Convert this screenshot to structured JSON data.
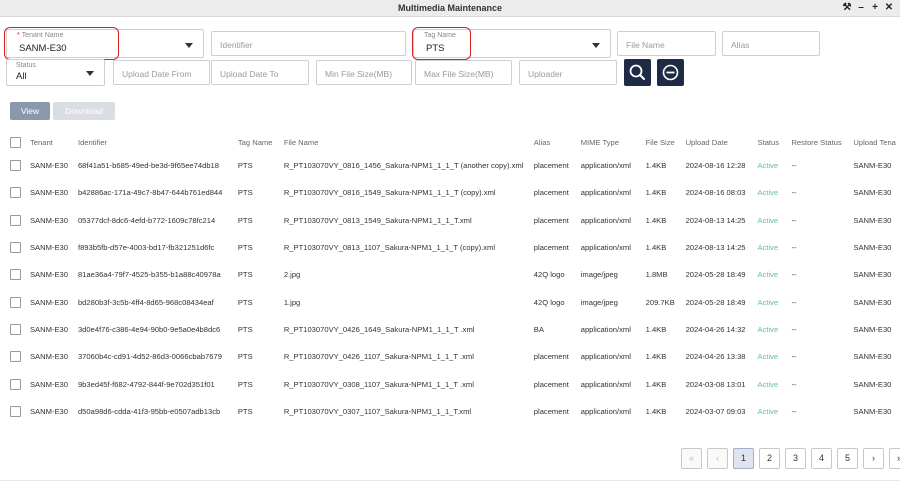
{
  "window": {
    "title": "Multimedia Maintenance",
    "controls": [
      "⚒",
      "–",
      "+",
      "✕"
    ]
  },
  "filters": {
    "tenant": {
      "label": "Tenant Name",
      "value": "SANM-E30"
    },
    "identifier_placeholder": "Identifier",
    "tag": {
      "label": "Tag Name",
      "value": "PTS"
    },
    "file_name_placeholder": "File Name",
    "alias_placeholder": "Alias",
    "status": {
      "label": "Status",
      "value": "All"
    },
    "upload_date_from_placeholder": "Upload Date From",
    "upload_date_to_placeholder": "Upload Date To",
    "min_size_placeholder": "Min File Size(MB)",
    "max_size_placeholder": "Max File Size(MB)",
    "uploader_placeholder": "Uploader"
  },
  "actions": {
    "view": "View",
    "download": "Download"
  },
  "table": {
    "headers": [
      "Tenant",
      "Identifier",
      "Tag Name",
      "File Name",
      "Alias",
      "MIME Type",
      "File Size",
      "Upload Date",
      "Status",
      "Restore Status",
      "Upload Tena"
    ],
    "rows": [
      [
        "SANM-E30",
        "68f41a51-b685-49ed-be3d-9f65ee74db18",
        "PTS",
        "R_PT103070VY_0816_1456_Sakura-NPM1_1_1_T (another copy).xml",
        "placement",
        "application/xml",
        "1.4KB",
        "2024-08-16 12:28",
        "Active",
        "--",
        "SANM-E30"
      ],
      [
        "SANM-E30",
        "b42886ac-171a-49c7-8b47-644b761ed844",
        "PTS",
        "R_PT103070VY_0816_1549_Sakura-NPM1_1_1_T (copy).xml",
        "placement",
        "application/xml",
        "1.4KB",
        "2024-08-16 08:03",
        "Active",
        "--",
        "SANM-E30"
      ],
      [
        "SANM-E30",
        "05377dcf-8dc6-4efd-b772-1609c78fc214",
        "PTS",
        "R_PT103070VY_0813_1549_Sakura-NPM1_1_1_T.xml",
        "placement",
        "application/xml",
        "1.4KB",
        "2024-08-13 14:25",
        "Active",
        "--",
        "SANM-E30"
      ],
      [
        "SANM-E30",
        "f893b5fb-d57e-4003-bd17-fb321251d6fc",
        "PTS",
        "R_PT103070VY_0813_1107_Sakura-NPM1_1_1_T (copy).xml",
        "placement",
        "application/xml",
        "1.4KB",
        "2024-08-13 14:25",
        "Active",
        "--",
        "SANM-E30"
      ],
      [
        "SANM-E30",
        "81ae36a4-79f7-4525-b355-b1a88c40978a",
        "PTS",
        "2.jpg",
        "42Q logo",
        "image/jpeg",
        "1.8MB",
        "2024-05-28 18:49",
        "Active",
        "--",
        "SANM-E30"
      ],
      [
        "SANM-E30",
        "bd280b3f-3c5b-4ff4-8d65-968c08434eaf",
        "PTS",
        "1.jpg",
        "42Q logo",
        "image/jpeg",
        "209.7KB",
        "2024-05-28 18:49",
        "Active",
        "--",
        "SANM-E30"
      ],
      [
        "SANM-E30",
        "3d0e4f76-c386-4e94-90b0-9e5a0e4b8dc6",
        "PTS",
        "R_PT103070VY_0426_1649_Sakura-NPM1_1_1_T .xml",
        "BA",
        "application/xml",
        "1.4KB",
        "2024-04-26 14:32",
        "Active",
        "--",
        "SANM-E30"
      ],
      [
        "SANM-E30",
        "37060b4c-cd91-4d52-86d3-0066cbab7679",
        "PTS",
        "R_PT103070VY_0426_1107_Sakura-NPM1_1_1_T .xml",
        "placement",
        "application/xml",
        "1.4KB",
        "2024-04-26 13:38",
        "Active",
        "--",
        "SANM-E30"
      ],
      [
        "SANM-E30",
        "9b3ed45f-f682-4792-844f-9e702d351f01",
        "PTS",
        "R_PT103070VY_0308_1107_Sakura-NPM1_1_1_T .xml",
        "placement",
        "application/xml",
        "1.4KB",
        "2024-03-08 13:01",
        "Active",
        "--",
        "SANM-E30"
      ],
      [
        "SANM-E30",
        "d50a98d6-cdda-41f3-95bb-e0507adb13cb",
        "PTS",
        "R_PT103070VY_0307_1107_Sakura-NPM1_1_1_T.xml",
        "placement",
        "application/xml",
        "1.4KB",
        "2024-03-07 09:03",
        "Active",
        "--",
        "SANM-E30"
      ]
    ]
  },
  "pagination": {
    "first": "«",
    "prev": "‹",
    "pages": [
      "1",
      "2",
      "3",
      "4",
      "5"
    ],
    "current": "1",
    "next": "›",
    "last": "»"
  },
  "colors": {
    "accent_dark": "#1f2a44",
    "active": "#5ec48c",
    "highlight": "#d92020"
  }
}
